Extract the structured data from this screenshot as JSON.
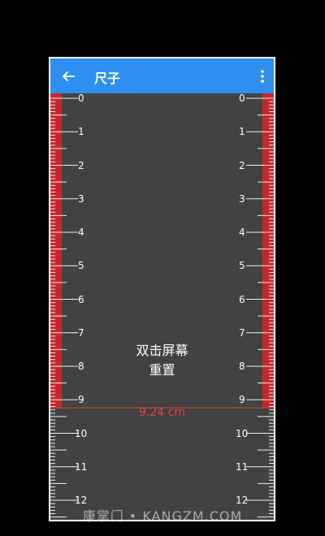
{
  "app": {
    "title": "尺子"
  },
  "ruler": {
    "labels": [
      "0",
      "1",
      "2",
      "3",
      "4",
      "5",
      "6",
      "7",
      "8",
      "9",
      "10",
      "11",
      "12"
    ],
    "unit": "cm",
    "measured_value": 9.24,
    "measured_text": "9.24 cm",
    "hint_line1": "双击屏幕",
    "hint_line2": "重置"
  },
  "watermark": "康掌门 • KANGZM.COM",
  "colors": {
    "appbar": "#2f8ff0",
    "ruler_bg": "#424242",
    "highlight": "#c62828",
    "measure_line": "#e0453d"
  },
  "icons": {
    "back": "arrow-left-icon",
    "more": "more-vertical-icon"
  }
}
